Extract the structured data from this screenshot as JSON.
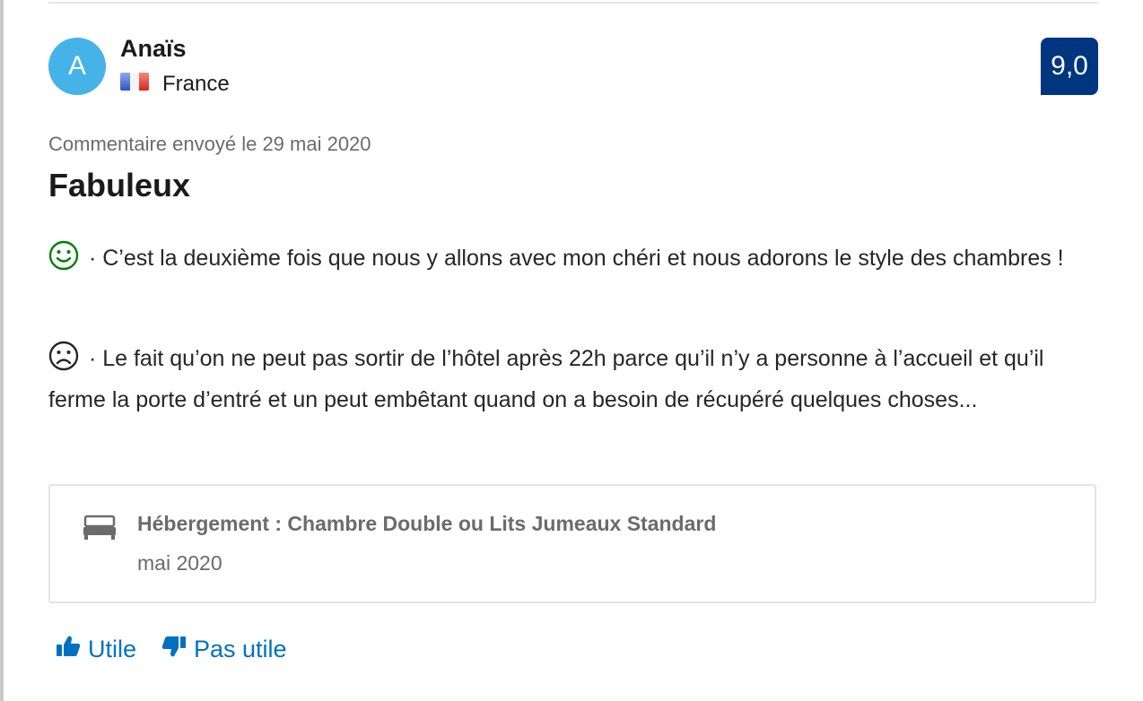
{
  "reviewer": {
    "initial": "A",
    "name": "Anaïs",
    "country": "France"
  },
  "score": "9,0",
  "review": {
    "date": "Commentaire envoyé le 29 mai 2020",
    "title": "Fabuleux",
    "positive": " · C’est la deuxième fois que nous y allons avec mon chéri et nous adorons le style des chambres !",
    "negative": " · Le fait qu’on ne peut pas sortir de l’hôtel après 22h parce qu’il n’y a personne à l’accueil et qu’il ferme la porte d’entré et un peut embêtant quand on a besoin de récupéré quelques choses..."
  },
  "stay": {
    "room": "Hébergement : Chambre Double ou Lits Jumeaux Standard",
    "date": "mai 2020"
  },
  "actions": {
    "helpful": "Utile",
    "not_helpful": "Pas utile"
  },
  "colors": {
    "avatar": "#45b3e7",
    "score_bg": "#003580",
    "link": "#0071c2",
    "positive_icon": "#008009",
    "negative_icon": "#262626"
  }
}
